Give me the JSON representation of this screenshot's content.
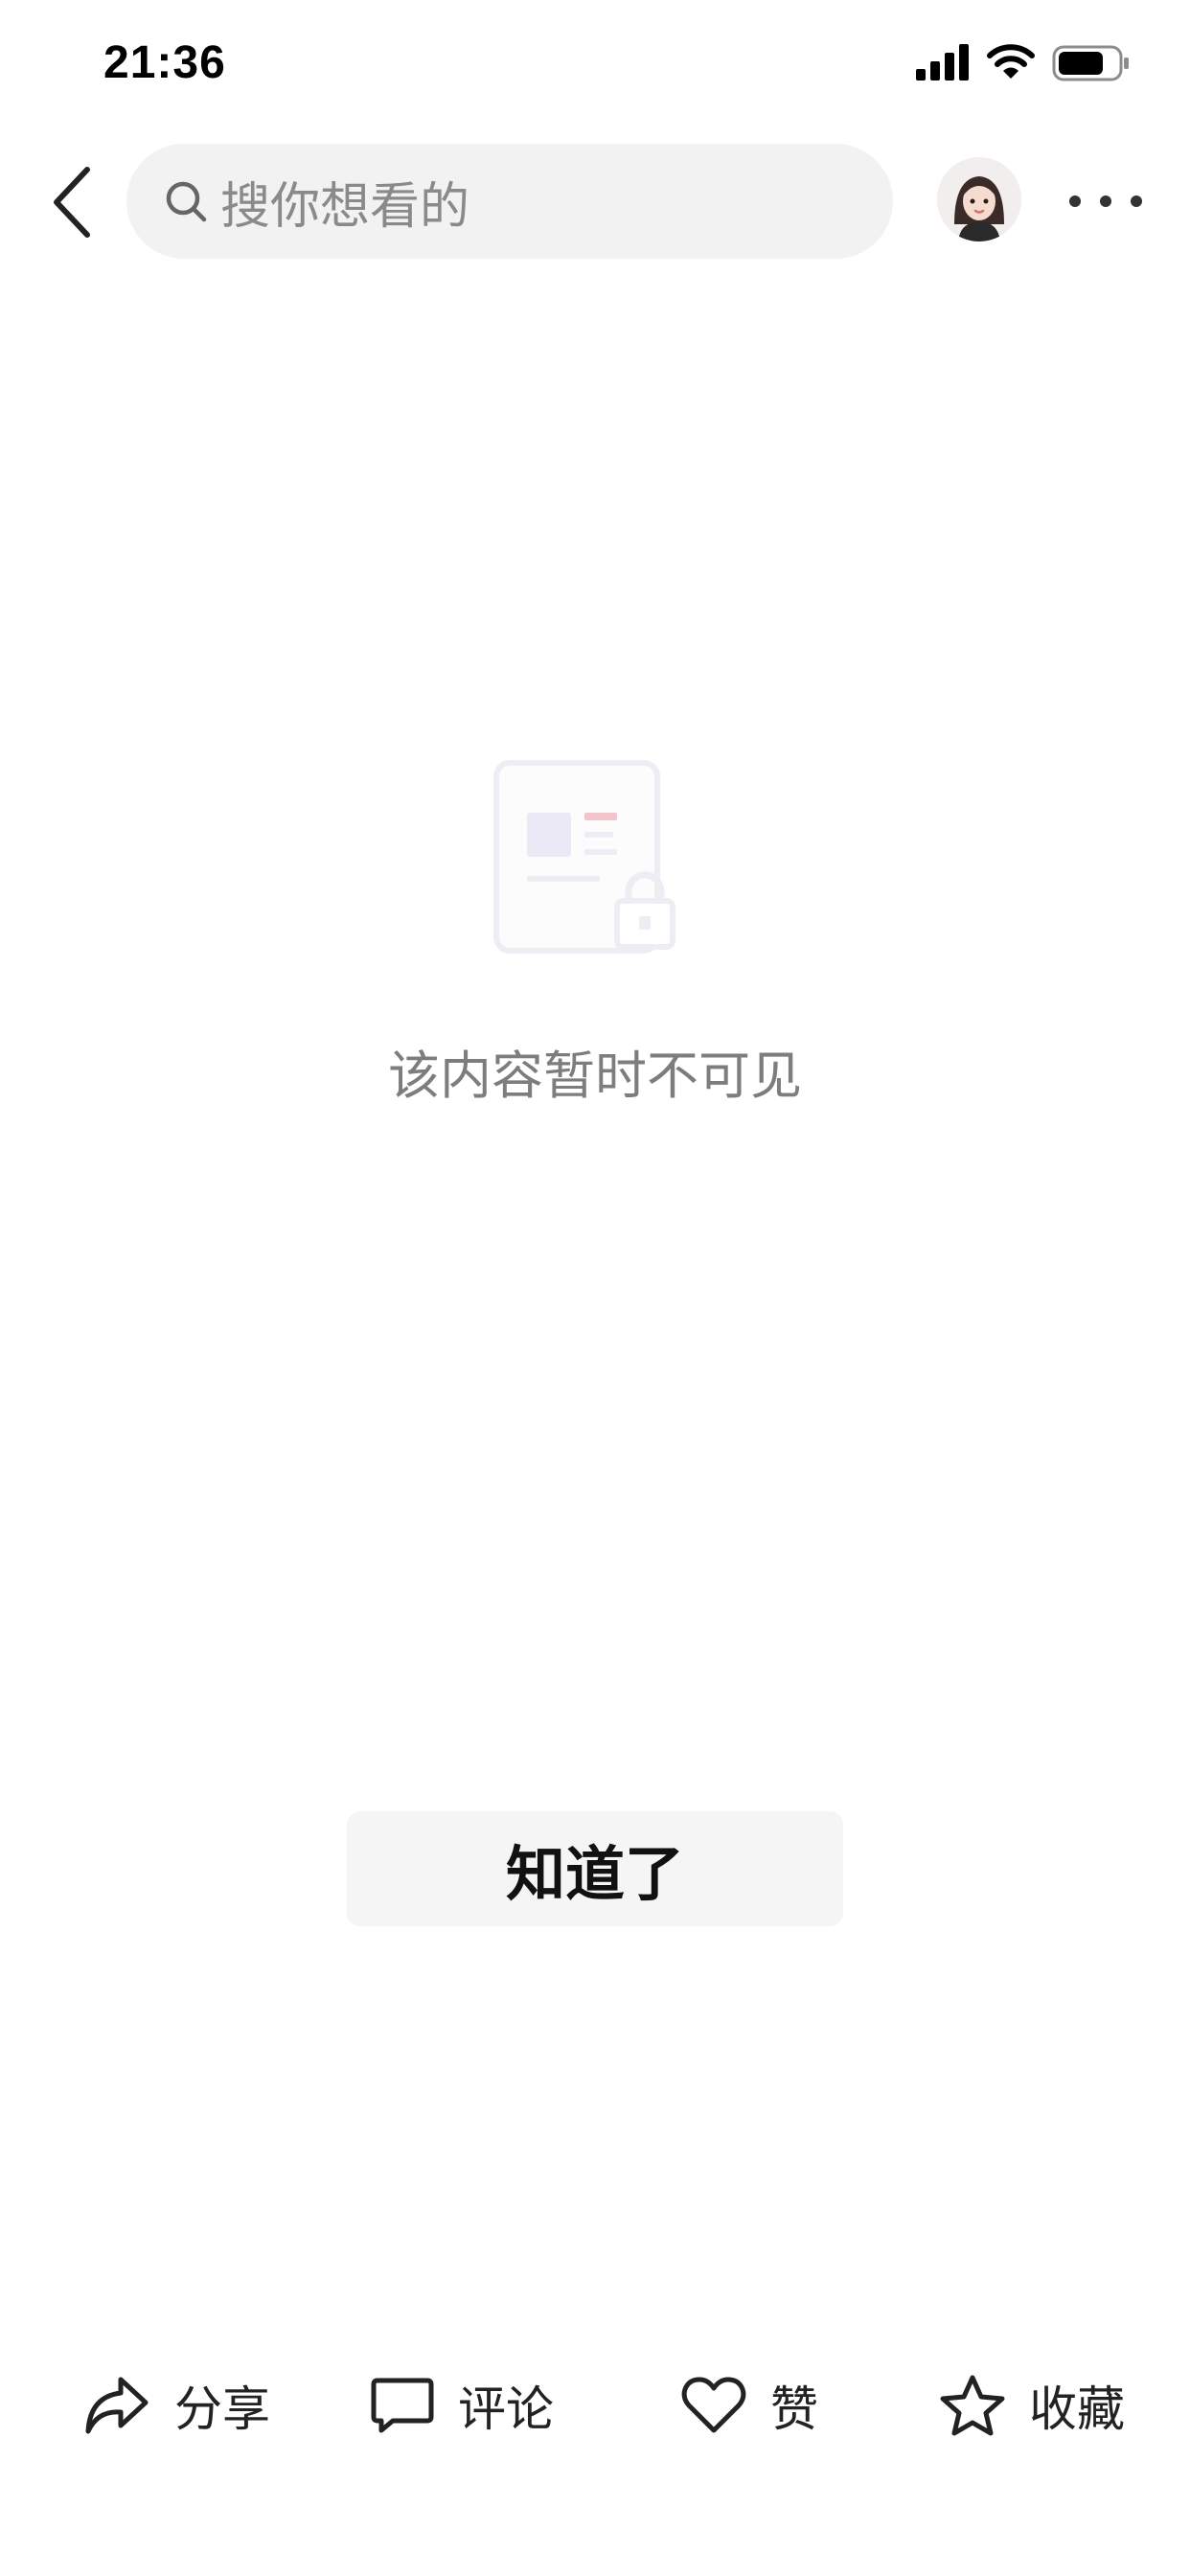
{
  "status_bar": {
    "time": "21:36"
  },
  "nav": {
    "search_placeholder": "搜你想看的"
  },
  "empty_state": {
    "message": "该内容暂时不可见"
  },
  "dialog": {
    "ok_label": "知道了"
  },
  "actions": {
    "share": "分享",
    "comment": "评论",
    "like": "赞",
    "collect": "收藏"
  },
  "colors": {
    "search_bg": "#f2f2f2",
    "button_bg": "#f5f5f5",
    "muted_text": "#7d7d7d",
    "illustration_accent": "#ef8a93"
  }
}
